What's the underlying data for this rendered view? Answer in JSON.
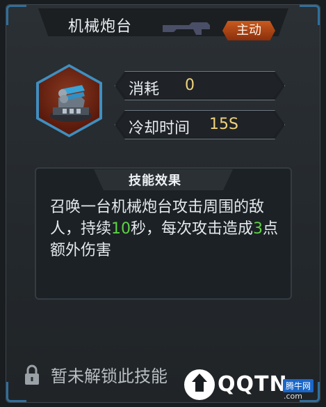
{
  "skill": {
    "title": "机械炮台",
    "type_badge": "主动",
    "cost_label": "消耗",
    "cost_value": "0",
    "cooldown_label": "冷却时间",
    "cooldown_value": "15S",
    "effect_title": "技能效果",
    "effect_parts": [
      "召唤一台机械炮台攻击周围的敌人，持续",
      "10",
      "秒，每次攻击造成",
      "3",
      "点额外伤害"
    ],
    "locked_text": "暂未解锁此技能",
    "highlight_color": "#5cd246"
  },
  "watermark": {
    "brand": "QQTN",
    "tag": "腾牛网",
    "url": ".com"
  },
  "colors": {
    "accent_blue": "#2f6f9b",
    "value_gold": "#f0d27a",
    "badge_orange": "#c85a1e"
  }
}
